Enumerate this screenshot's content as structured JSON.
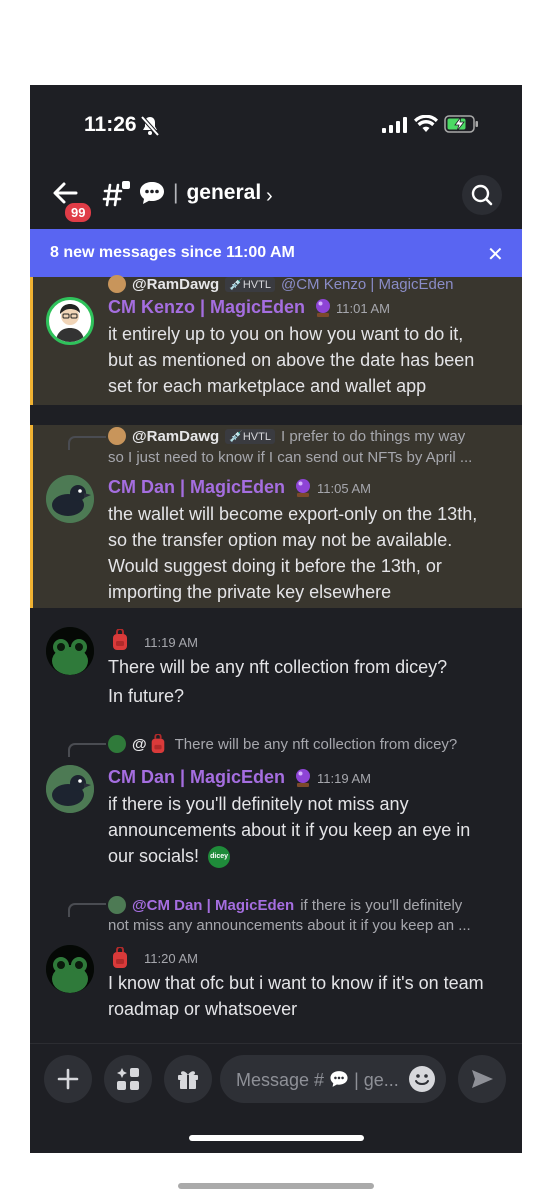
{
  "status": {
    "time": "11:26"
  },
  "header": {
    "badge": "99",
    "channel": "general"
  },
  "banner": {
    "text": "8 new messages since 11:00 AM"
  },
  "messages": [
    {
      "reply_name": "@RamDawg",
      "reply_tag": "HVTL",
      "reply_text": "@CM Kenzo | MagicEden",
      "author": "CM Kenzo | MagicEden",
      "time": "11:01 AM",
      "lines": [
        "it entirely up to you on how you want to do it,",
        "but as mentioned on above the date has been",
        "set for each marketplace and wallet app"
      ]
    },
    {
      "reply_name": "@RamDawg",
      "reply_tag": "HVTL",
      "reply_text": "I prefer to do things my way",
      "reply_text2": "so I just need to know if I can send out NFTs by April ...",
      "author": "CM Dan | MagicEden",
      "time": "11:05 AM",
      "lines": [
        "the wallet will become export-only on the 13th,",
        "so the transfer option may not be available.",
        "Would suggest doing it before the 13th, or",
        "importing the private key elsewhere"
      ]
    },
    {
      "time": "11:19 AM",
      "lines": [
        "There will be any nft collection from dicey?",
        "In future?"
      ]
    },
    {
      "reply_name": "@",
      "reply_text": "There will be any nft collection from dicey?",
      "author": "CM Dan | MagicEden",
      "time": "11:19 AM",
      "lines": [
        "if there is you'll definitely not miss any",
        "announcements about it if you keep an eye in",
        "our socials!"
      ]
    },
    {
      "reply_name": "@CM Dan | MagicEden",
      "reply_text": "if there is you'll definitely",
      "reply_text2": "not miss any announcements about it if you keep an ...",
      "time": "11:20 AM",
      "lines": [
        "I know that ofc but i want to know if it's on team",
        "roadmap or whatsoever"
      ]
    }
  ],
  "composer": {
    "placeholder": "Message #",
    "placeholder_tail": "| ge..."
  },
  "emoji_label": "dicey",
  "colors": {
    "accent": "#5965f2",
    "role": "#a56ee0",
    "highlight": "#39362e",
    "highlight_bar": "#f0b232",
    "badge": "#e03c47"
  }
}
